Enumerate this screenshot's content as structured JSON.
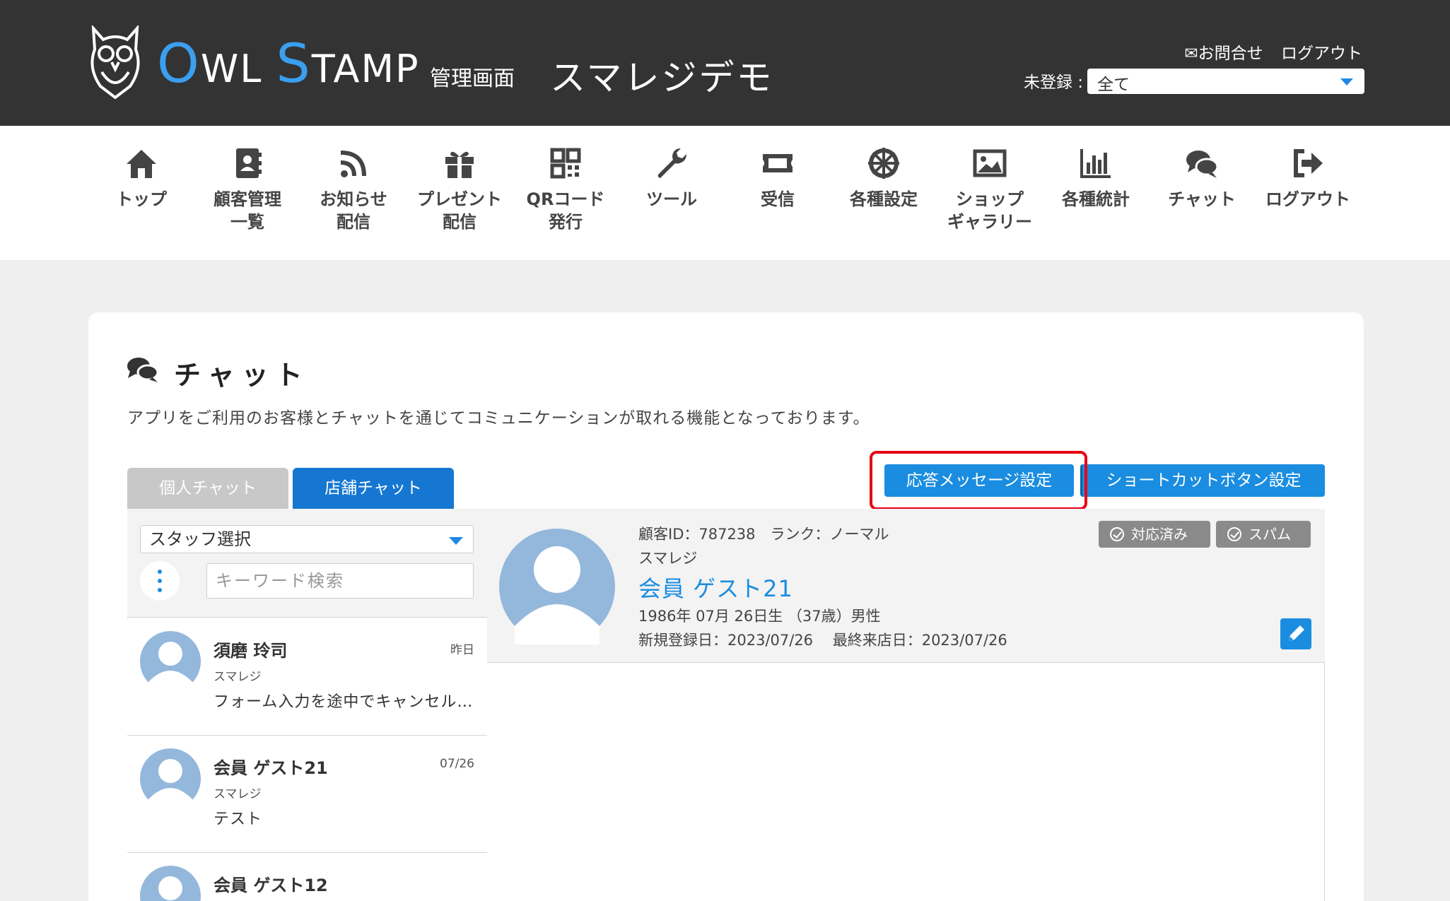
{
  "header": {
    "logo_text": "OWL STAMP",
    "logo_sub": "管理画面",
    "shop_name": "スマレジデモ",
    "contact_label": "✉お問合せ",
    "logout_label": "ログアウト",
    "unregistered_label": "未登録 :",
    "unregistered_value": "全て"
  },
  "nav": [
    {
      "label": "トップ",
      "icon": "home-icon"
    },
    {
      "label": "顧客管理\n一覧",
      "icon": "address-book-icon"
    },
    {
      "label": "お知らせ\n配信",
      "icon": "rss-icon"
    },
    {
      "label": "プレゼント\n配信",
      "icon": "gift-icon"
    },
    {
      "label": "QRコード\n発行",
      "icon": "qrcode-icon"
    },
    {
      "label": "ツール",
      "icon": "wrench-icon"
    },
    {
      "label": "受信",
      "icon": "ticket-icon"
    },
    {
      "label": "各種設定",
      "icon": "settings-wheel-icon"
    },
    {
      "label": "ショップ\nギャラリー",
      "icon": "image-icon"
    },
    {
      "label": "各種統計",
      "icon": "bar-chart-icon"
    },
    {
      "label": "チャット",
      "icon": "chat-icon"
    },
    {
      "label": "ログアウト",
      "icon": "sign-out-icon"
    }
  ],
  "page": {
    "title": "チャット",
    "description": "アプリをご利用のお客様とチャットを通じてコミュニケーションが取れる機能となっております。"
  },
  "tabs": {
    "personal": "個人チャット",
    "store": "店舗チャット"
  },
  "buttons": {
    "reply_settings": "応答メッセージ設定",
    "shortcut_settings": "ショートカットボタン設定"
  },
  "filter": {
    "staff_select": "スタッフ選択",
    "keyword_placeholder": "キーワード検索"
  },
  "chat_list": [
    {
      "name": "須磨 玲司",
      "date": "昨日",
      "shop": "スマレジ",
      "message": "フォーム入力を途中でキャンセルしたい"
    },
    {
      "name": "会員 ゲスト21",
      "date": "07/26",
      "shop": "スマレジ",
      "message": "テスト"
    },
    {
      "name": "会員 ゲスト12",
      "date": "",
      "shop": "",
      "message": ""
    }
  ],
  "customer": {
    "id_rank": "顧客ID：787238　ランク：ノーマル",
    "shop": "スマレジ",
    "name": "会員 ゲスト21",
    "birth": "1986年 07月 26日生 （37歳）男性",
    "dates": "新規登録日：2023/07/26　 最終来店日：2023/07/26",
    "tag_done": "対応済み",
    "tag_spam": "スパム"
  },
  "colors": {
    "header_bg": "#333333",
    "accent": "#1a8de0",
    "highlight": "#e60012"
  }
}
